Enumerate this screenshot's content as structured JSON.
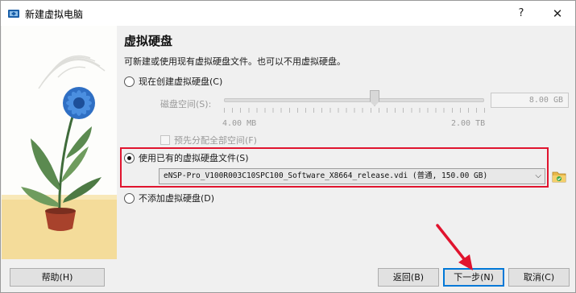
{
  "window": {
    "title": "新建虚拟电脑",
    "help_glyph": "?",
    "close_glyph": "✕"
  },
  "main": {
    "heading": "虚拟硬盘",
    "description": "可新建或使用现有虚拟硬盘文件。也可以不用虚拟硬盘。",
    "options": {
      "create_new": {
        "label": "现在创建虚拟硬盘(C)",
        "selected": false
      },
      "use_existing": {
        "label": "使用已有的虚拟硬盘文件(S)",
        "selected": true
      },
      "no_disk": {
        "label": "不添加虚拟硬盘(D)",
        "selected": false
      }
    },
    "disk_space": {
      "label": "磁盘空间(S):",
      "value": "8.00 GB",
      "min_label": "4.00 MB",
      "max_label": "2.00 TB",
      "preallocate_label": "预先分配全部空间(F)",
      "preallocate_checked": false
    },
    "existing_file": {
      "value": "eNSP-Pro_V100R003C10SPC100_Software_X8664_release.vdi (普通, 150.00 GB)"
    }
  },
  "footer": {
    "help_label": "帮助(H)",
    "back_label": "返回(B)",
    "next_label": "下一步(N)",
    "cancel_label": "取消(C)"
  },
  "colors": {
    "annotation_red": "#e0142e",
    "default_button_blue": "#0078d7"
  }
}
